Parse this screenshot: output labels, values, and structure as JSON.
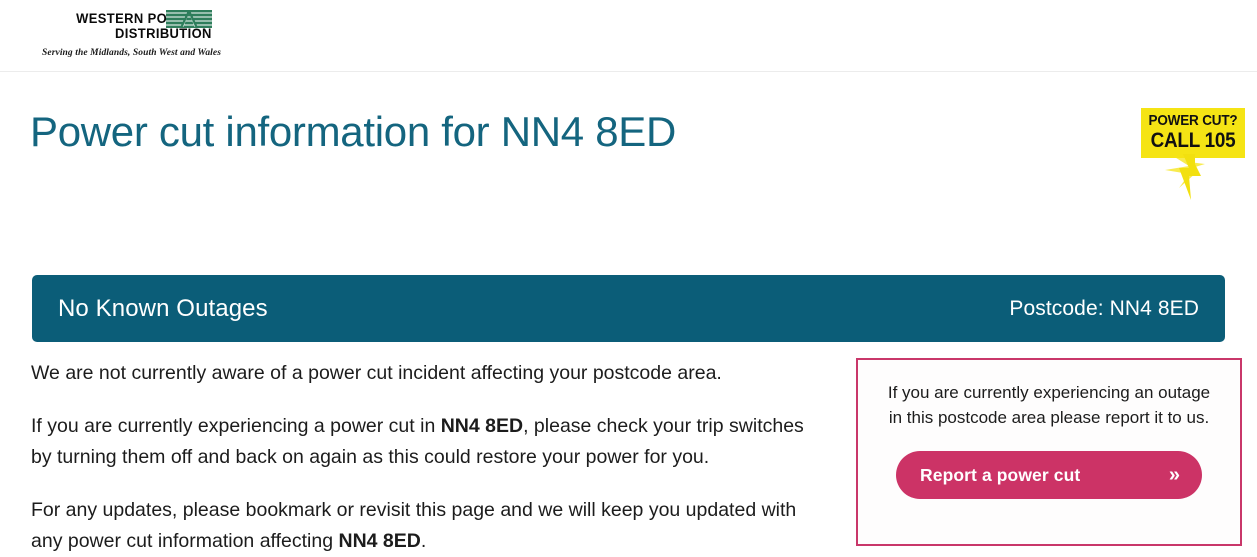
{
  "header": {
    "logo": {
      "line1": "WESTERN POWER",
      "line2": "DISTRIBUTION",
      "tagline": "Serving the Midlands, South West and Wales"
    }
  },
  "page": {
    "title": "Power cut information for NN4 8ED"
  },
  "call105_badge": {
    "line1": "POWER CUT?",
    "line2": "CALL 105"
  },
  "status_banner": {
    "status": "No Known Outages",
    "postcode_label": "Postcode: NN4 8ED"
  },
  "body": {
    "paragraph1": "We are not currently aware of a power cut incident affecting your postcode area.",
    "paragraph2_part1": "If you are currently experiencing a power cut in ",
    "paragraph2_postcode": "NN4 8ED",
    "paragraph2_part2": ", please check your trip switches by turning them off and back on again as this could restore your power for you.",
    "paragraph3_part1": "For any updates, please bookmark or revisit this page and we will keep you updated with any power cut information affecting ",
    "paragraph3_postcode": "NN4 8ED",
    "paragraph3_part2": "."
  },
  "report_box": {
    "text": "If you are currently experiencing an outage in this postcode area please report it to us.",
    "button_label": "Report a power cut",
    "button_chevron": "»"
  },
  "colors": {
    "teal": "#0b5d78",
    "title_teal": "#14657f",
    "pink": "#cc3366",
    "pink_border": "#c9376a",
    "badge_yellow": "#f5e414",
    "logo_green": "#2e7d5b"
  }
}
